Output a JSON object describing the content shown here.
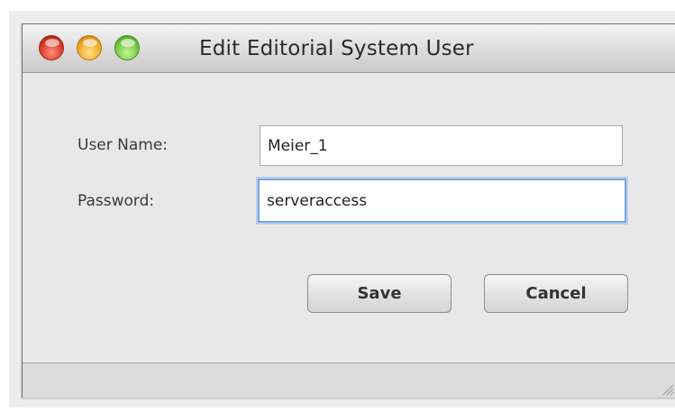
{
  "window": {
    "title": "Edit Editorial System User",
    "controls": [
      "close-button",
      "minimize-button",
      "zoom-button"
    ]
  },
  "form": {
    "username_label": "User Name:",
    "username_value": "Meier_1",
    "password_label": "Password:",
    "password_value": "serveraccess",
    "focused_field": "password"
  },
  "buttons": {
    "save_label": "Save",
    "cancel_label": "Cancel"
  },
  "colors": {
    "focus_ring": "#7aa6de",
    "close": "#d8331f",
    "minimize": "#f0a623",
    "zoom": "#6fc53a"
  }
}
